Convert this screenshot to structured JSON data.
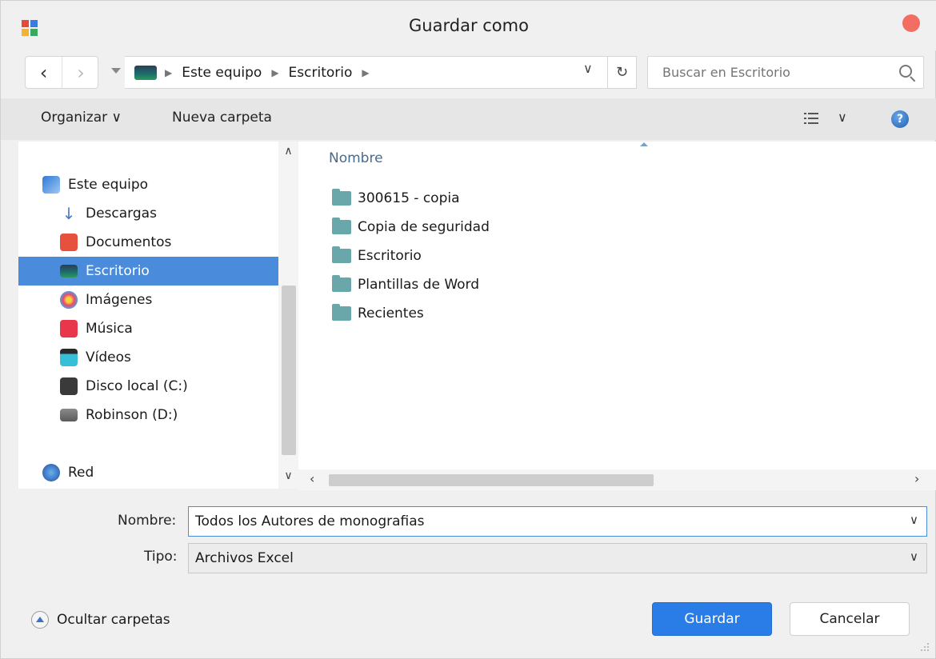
{
  "window": {
    "title": "Guardar como"
  },
  "address_bar": {
    "crumbs": [
      "Este equipo",
      "Escritorio"
    ],
    "search_placeholder": "Buscar en Escritorio"
  },
  "toolbar": {
    "organize_label": "Organizar ∨",
    "new_folder_label": "Nueva carpeta"
  },
  "nav_pane": {
    "items": [
      {
        "label": "Este equipo",
        "icon": "computer-icon"
      },
      {
        "label": "Descargas",
        "icon": "download-icon"
      },
      {
        "label": "Documentos",
        "icon": "documents-icon"
      },
      {
        "label": "Escritorio",
        "icon": "desktop-icon",
        "selected": true
      },
      {
        "label": "Imágenes",
        "icon": "pictures-icon"
      },
      {
        "label": "Música",
        "icon": "music-icon"
      },
      {
        "label": "Vídeos",
        "icon": "videos-icon"
      },
      {
        "label": "Disco local (C:)",
        "icon": "drive-icon"
      },
      {
        "label": "Robinson (D:)",
        "icon": "drive-icon"
      },
      {
        "label": "Red",
        "icon": "network-icon"
      }
    ]
  },
  "file_list": {
    "column_header": "Nombre",
    "items": [
      "300615 - copia",
      "Copia de seguridad",
      "Escritorio",
      "Plantillas de Word",
      "Recientes"
    ]
  },
  "form": {
    "name_label": "Nombre:",
    "name_value": "Todos los Autores de monografias",
    "type_label": "Tipo:",
    "type_value": "Archivos Excel"
  },
  "footer": {
    "hide_folders_label": "Ocultar carpetas",
    "save_label": "Guardar",
    "cancel_label": "Cancelar"
  },
  "colors": {
    "selection": "#4a8cdb",
    "primary_button": "#2a7de6",
    "close_button": "#f26d62",
    "folder": "#6aa7aa"
  }
}
